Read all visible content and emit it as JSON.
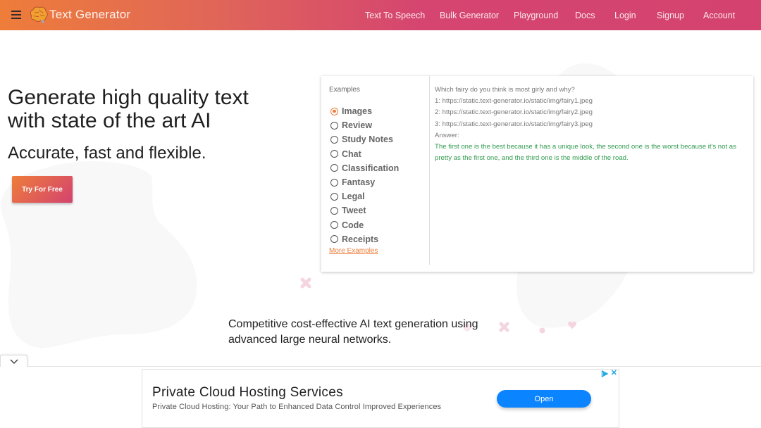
{
  "header": {
    "brand": "Text Generator",
    "nav": [
      {
        "label": "Text To Speech"
      },
      {
        "label": "Bulk Generator"
      },
      {
        "label": "Playground"
      },
      {
        "label": "Docs"
      },
      {
        "label": "Login"
      },
      {
        "label": "Signup"
      },
      {
        "label": "Account"
      }
    ],
    "gradient_start": "#ee7d3a",
    "gradient_end": "#d4436f"
  },
  "hero": {
    "title_line1": "Generate high quality text",
    "title_line2": "with state of the art AI",
    "subtitle": "Accurate, fast and flexible.",
    "cta_label": "Try For Free"
  },
  "examples": {
    "label": "Examples",
    "selected": "Images",
    "items": [
      {
        "label": "Images",
        "checked": true
      },
      {
        "label": "Review",
        "checked": false
      },
      {
        "label": "Study Notes",
        "checked": false
      },
      {
        "label": "Chat",
        "checked": false
      },
      {
        "label": "Classification",
        "checked": false
      },
      {
        "label": "Fantasy",
        "checked": false
      },
      {
        "label": "Legal",
        "checked": false
      },
      {
        "label": "Tweet",
        "checked": false
      },
      {
        "label": "Code",
        "checked": false
      },
      {
        "label": "Receipts",
        "checked": false
      }
    ],
    "more_link": "More Examples",
    "prompt_lines": [
      "Which fairy do you think is most girly and why?",
      "1: https://static.text-generator.io/static/img/fairy1.jpeg",
      "2: https://static.text-generator.io/static/img/fairy2.jpeg",
      "3: https://static.text-generator.io/static/img/fairy3.jpeg",
      "Answer:"
    ],
    "answer": "The first one is the best because it has a unique look, the second one is the worst because it's not as pretty as the first one, and the third one is the middle of the road.",
    "accent_color": "#ee7d3a",
    "answer_color": "#2e9a4d"
  },
  "tagline": "Competitive cost-effective AI text generation using advanced large neural networks.",
  "ad": {
    "title": "Private Cloud Hosting Services",
    "description": "Private Cloud Hosting: Your Path to Enhanced Data Control Improved Experiences",
    "button_label": "Open",
    "close_glyph": "✕",
    "button_color": "#0a84ff"
  }
}
